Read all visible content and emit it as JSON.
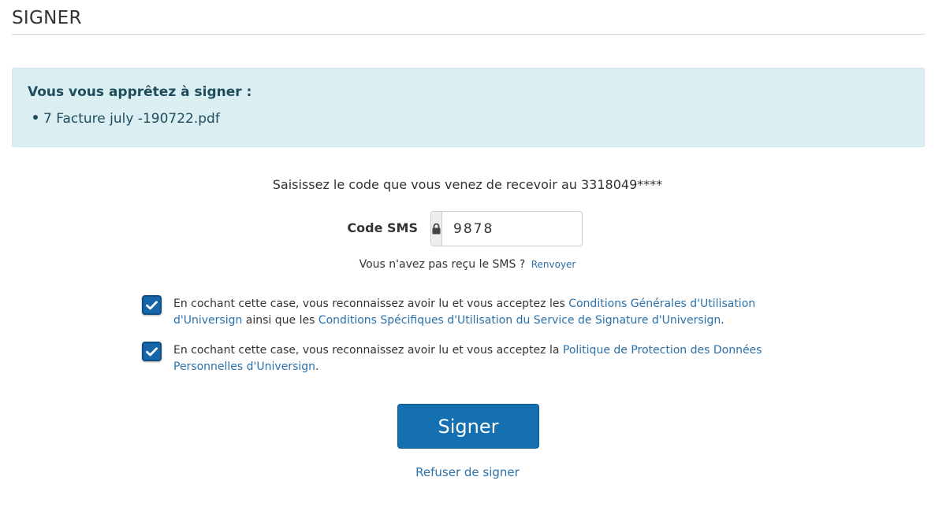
{
  "header": {
    "title": "SIGNER"
  },
  "documents": {
    "heading": "Vous vous apprêtez à signer :",
    "items": [
      "7 Facture july -190722.pdf"
    ]
  },
  "sms": {
    "instruction": "Saisissez le code que vous venez de recevoir au 3318049****",
    "label": "Code SMS",
    "icon": "lock-icon",
    "value": "9878",
    "not_received": "Vous n'avez pas reçu le SMS ?",
    "resend_label": "Renvoyer"
  },
  "consents": [
    {
      "checked": true,
      "prefix": "En cochant cette case, vous reconnaissez avoir lu et vous acceptez les ",
      "link1": "Conditions Générales d'Utilisation d'Universign",
      "middle": " ainsi que les ",
      "link2": "Conditions Spécifiques d'Utilisation du Service de Signature d'Universign",
      "suffix": "."
    },
    {
      "checked": true,
      "prefix": "En cochant cette case, vous reconnaissez avoir lu et vous acceptez la ",
      "link1": "Politique de Protection des Données Personnelles d'Universign",
      "suffix": "."
    }
  ],
  "actions": {
    "sign_label": "Signer",
    "refuse_label": "Refuser de signer"
  },
  "colors": {
    "primary": "#1470b0",
    "link": "#2b70a8",
    "info_background": "#dbeff3",
    "info_text": "#1e4e5c"
  }
}
